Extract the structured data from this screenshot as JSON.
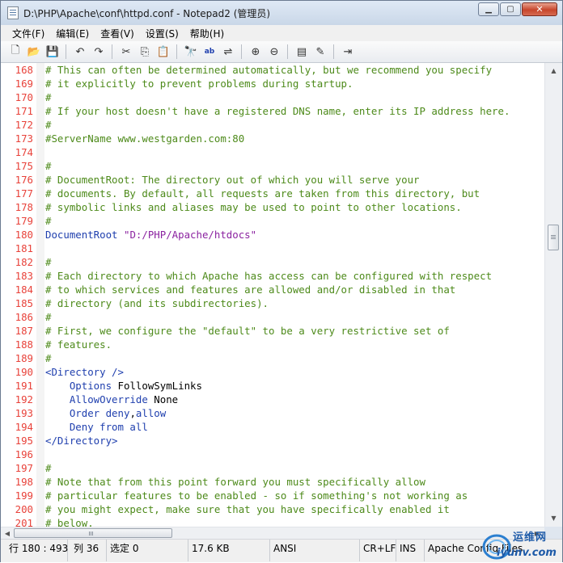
{
  "window": {
    "title": "D:\\PHP\\Apache\\conf\\httpd.conf - Notepad2 (管理员)",
    "app_icon": "notepad-icon",
    "controls": [
      "minimize-icon",
      "maximize-icon",
      "close-icon"
    ]
  },
  "menu": {
    "items": [
      "文件(F)",
      "编辑(E)",
      "查看(V)",
      "设置(S)",
      "帮助(H)"
    ]
  },
  "toolbar": {
    "buttons": [
      {
        "icon": "new-file-icon",
        "glyph": "🗋"
      },
      {
        "icon": "open-folder-icon",
        "glyph": "📂"
      },
      {
        "icon": "save-icon",
        "glyph": "💾"
      },
      {
        "icon": "undo-icon",
        "glyph": "↶"
      },
      {
        "icon": "redo-icon",
        "glyph": "↷"
      },
      {
        "icon": "cut-icon",
        "glyph": "✂"
      },
      {
        "icon": "copy-icon",
        "glyph": "⎘"
      },
      {
        "icon": "paste-icon",
        "glyph": "📋"
      },
      {
        "icon": "find-icon",
        "glyph": "🔭"
      },
      {
        "icon": "replace-icon",
        "glyph": "ab"
      },
      {
        "icon": "word-wrap-icon",
        "glyph": "⇌"
      },
      {
        "icon": "zoom-in-icon",
        "glyph": "⊕"
      },
      {
        "icon": "zoom-out-icon",
        "glyph": "⊖"
      },
      {
        "icon": "scheme-icon",
        "glyph": "▤"
      },
      {
        "icon": "customize-icon",
        "glyph": "✎"
      },
      {
        "icon": "exit-icon",
        "glyph": "⇥"
      }
    ]
  },
  "editor": {
    "lines": [
      {
        "num": "168",
        "segments": [
          {
            "t": "# This can often be determined automatically, but we recommend you specify",
            "c": "c"
          }
        ]
      },
      {
        "num": "169",
        "segments": [
          {
            "t": "# it explicitly to prevent problems during startup.",
            "c": "c"
          }
        ]
      },
      {
        "num": "170",
        "segments": [
          {
            "t": "#",
            "c": "c"
          }
        ]
      },
      {
        "num": "171",
        "segments": [
          {
            "t": "# If your host doesn't have a registered DNS name, enter its IP address here.",
            "c": "c"
          }
        ]
      },
      {
        "num": "172",
        "segments": [
          {
            "t": "#",
            "c": "c"
          }
        ]
      },
      {
        "num": "173",
        "segments": [
          {
            "t": "#ServerName www.westgarden.com:80",
            "c": "c"
          }
        ]
      },
      {
        "num": "174",
        "segments": []
      },
      {
        "num": "175",
        "segments": [
          {
            "t": "#",
            "c": "c"
          }
        ]
      },
      {
        "num": "176",
        "segments": [
          {
            "t": "# DocumentRoot: The directory out of which you will serve your",
            "c": "c"
          }
        ]
      },
      {
        "num": "177",
        "segments": [
          {
            "t": "# documents. By default, all requests are taken from this directory, but",
            "c": "c"
          }
        ]
      },
      {
        "num": "178",
        "segments": [
          {
            "t": "# symbolic links and aliases may be used to point to other locations.",
            "c": "c"
          }
        ]
      },
      {
        "num": "179",
        "segments": [
          {
            "t": "#",
            "c": "c"
          }
        ]
      },
      {
        "num": "180",
        "segments": [
          {
            "t": "DocumentRoot ",
            "c": "k"
          },
          {
            "t": "\"D:/PHP/Apache/htdocs\"",
            "c": "s"
          }
        ]
      },
      {
        "num": "181",
        "segments": []
      },
      {
        "num": "182",
        "segments": [
          {
            "t": "#",
            "c": "c"
          }
        ]
      },
      {
        "num": "183",
        "segments": [
          {
            "t": "# Each directory to which Apache has access can be configured with respect",
            "c": "c"
          }
        ]
      },
      {
        "num": "184",
        "segments": [
          {
            "t": "# to which services and features are allowed and/or disabled in that",
            "c": "c"
          }
        ]
      },
      {
        "num": "185",
        "segments": [
          {
            "t": "# directory (and its subdirectories).",
            "c": "c"
          }
        ]
      },
      {
        "num": "186",
        "segments": [
          {
            "t": "#",
            "c": "c"
          }
        ]
      },
      {
        "num": "187",
        "segments": [
          {
            "t": "# First, we configure the \"default\" to be a very restrictive set of",
            "c": "c"
          }
        ]
      },
      {
        "num": "188",
        "segments": [
          {
            "t": "# features.",
            "c": "c"
          }
        ]
      },
      {
        "num": "189",
        "segments": [
          {
            "t": "#",
            "c": "c"
          }
        ]
      },
      {
        "num": "190",
        "segments": [
          {
            "t": "<Directory />",
            "c": "k"
          }
        ]
      },
      {
        "num": "191",
        "segments": [
          {
            "t": "    Options ",
            "c": "k"
          },
          {
            "t": "FollowSymLinks",
            "c": "v"
          }
        ]
      },
      {
        "num": "192",
        "segments": [
          {
            "t": "    AllowOverride ",
            "c": "k"
          },
          {
            "t": "None",
            "c": "v"
          }
        ]
      },
      {
        "num": "193",
        "segments": [
          {
            "t": "    Order deny",
            "c": "k"
          },
          {
            "t": ",",
            "c": "v"
          },
          {
            "t": "allow",
            "c": "k"
          }
        ]
      },
      {
        "num": "194",
        "segments": [
          {
            "t": "    Deny from all",
            "c": "k"
          }
        ]
      },
      {
        "num": "195",
        "segments": [
          {
            "t": "</Directory>",
            "c": "k"
          }
        ]
      },
      {
        "num": "196",
        "segments": []
      },
      {
        "num": "197",
        "segments": [
          {
            "t": "#",
            "c": "c"
          }
        ]
      },
      {
        "num": "198",
        "segments": [
          {
            "t": "# Note that from this point forward you must specifically allow",
            "c": "c"
          }
        ]
      },
      {
        "num": "199",
        "segments": [
          {
            "t": "# particular features to be enabled - so if something's not working as",
            "c": "c"
          }
        ]
      },
      {
        "num": "200",
        "segments": [
          {
            "t": "# you might expect, make sure that you have specifically enabled it",
            "c": "c"
          }
        ]
      },
      {
        "num": "201",
        "segments": [
          {
            "t": "# below.",
            "c": "c"
          }
        ]
      }
    ]
  },
  "status": {
    "position": "行 180 : 493",
    "column": "列 36",
    "selection": "选定 0",
    "size": "17.6 KB",
    "encoding": "ANSI",
    "line_ending": "CR+LF",
    "mode": "INS",
    "scheme": "Apache Config Files"
  },
  "watermark": {
    "line1": "运维网",
    "line2": "iyunv.com"
  },
  "colors": {
    "comment": "#4d8a1a",
    "keyword": "#1f3fae",
    "string": "#8b22a0",
    "line_number": "#e8423a"
  }
}
